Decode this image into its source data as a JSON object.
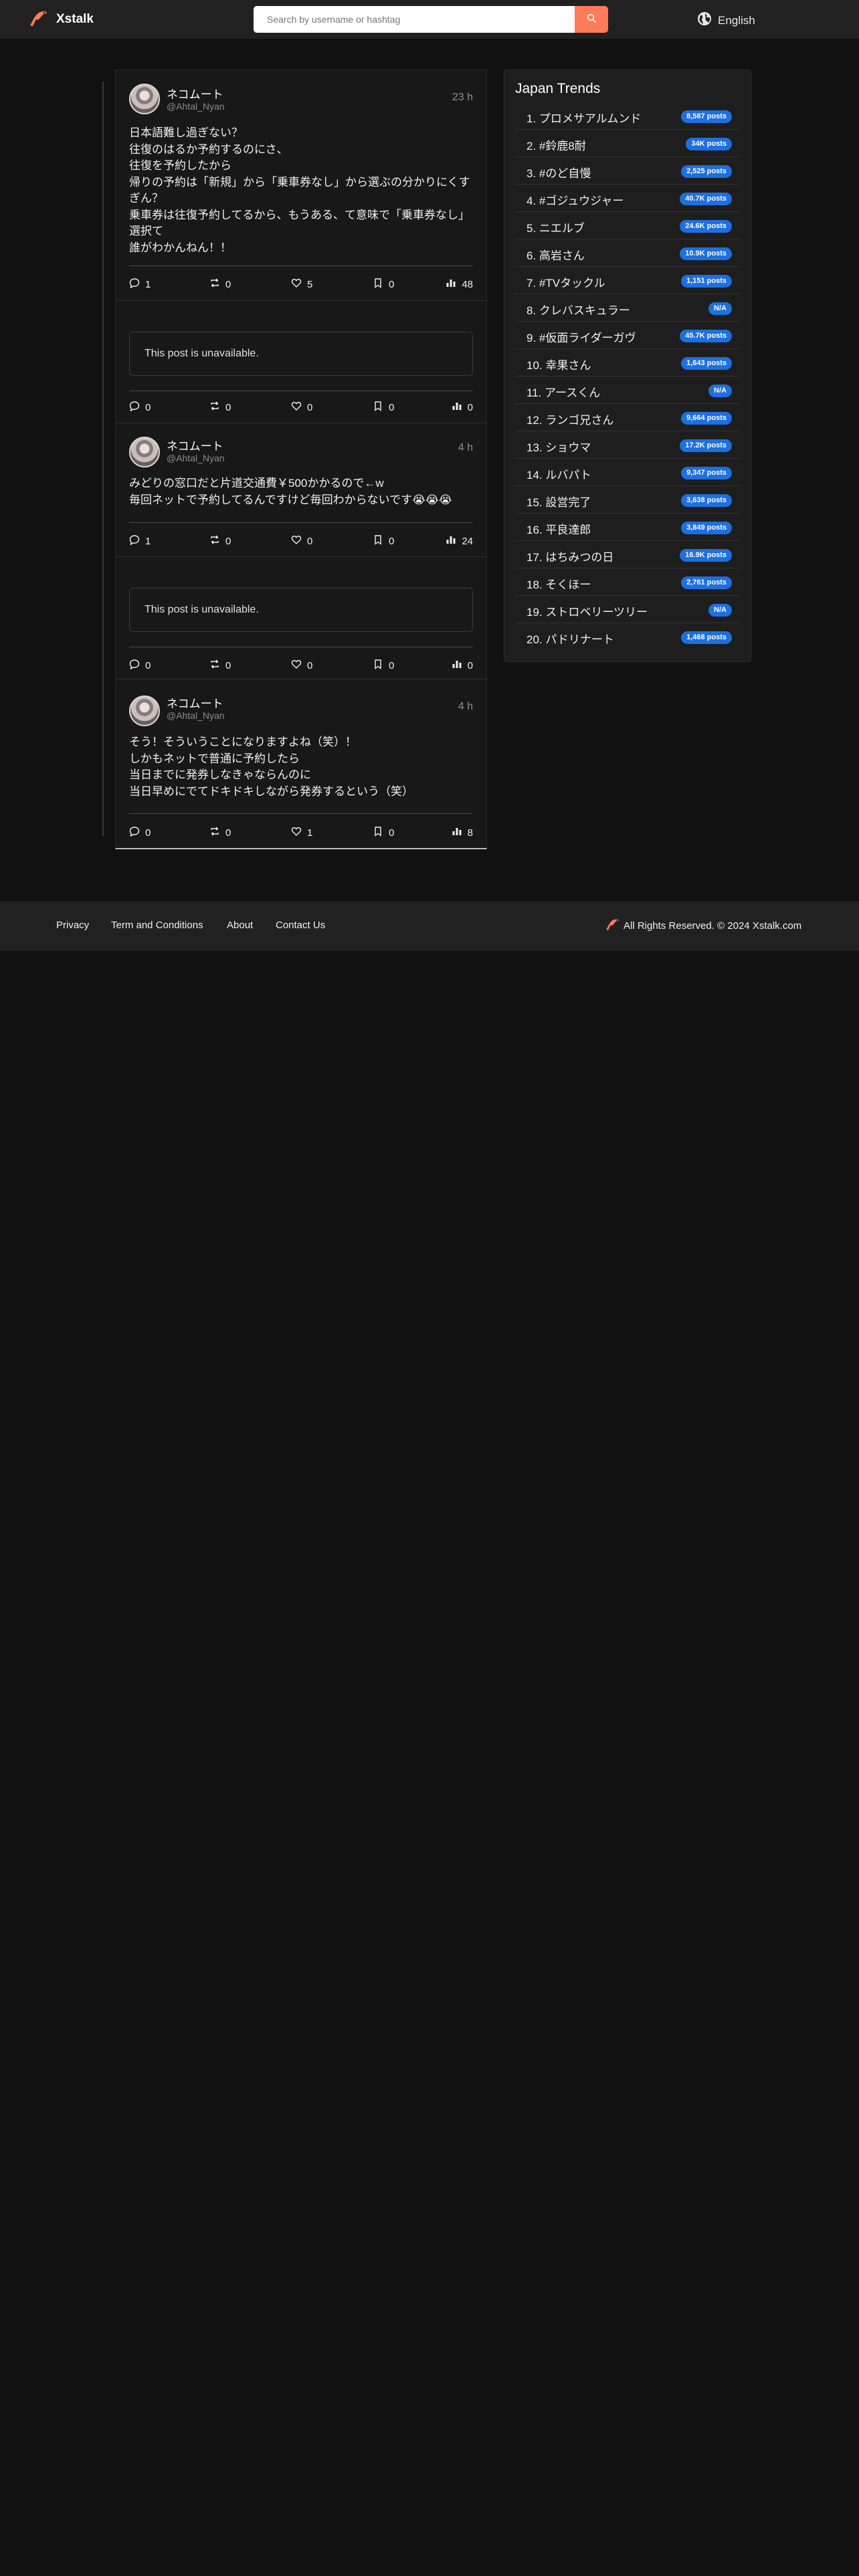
{
  "header": {
    "logo_text": "Xstalk",
    "search_placeholder": "Search by username or hashtag",
    "language": "English"
  },
  "posts": [
    {
      "type": "post",
      "user": "ネコムート",
      "handle": "@Ahtal_Nyan",
      "time": "23 h",
      "text": "日本語難し過ぎない？\n往復のはるか予約するのにさ、\n往復を予約したから\n帰りの予約は「新規」から「乗車券なし」から選ぶの分かりにくすぎん？\n乗車券は往復予約してるから、もうある、て意味で「乗車券なし」選択て\n誰がわかんねん！！",
      "replies": "1",
      "retweets": "0",
      "likes": "5",
      "bookmarks": "0",
      "views": "48"
    },
    {
      "type": "unavailable",
      "message": "This post is unavailable.",
      "replies": "0",
      "retweets": "0",
      "likes": "0",
      "bookmarks": "0",
      "views": "0"
    },
    {
      "type": "post",
      "user": "ネコムート",
      "handle": "@Ahtal_Nyan",
      "time": "4 h",
      "text": "みどりの窓口だと片道交通費￥500かかるので←w\n毎回ネットで予約してるんですけど毎回わからないです😭😭😭",
      "replies": "1",
      "retweets": "0",
      "likes": "0",
      "bookmarks": "0",
      "views": "24"
    },
    {
      "type": "unavailable",
      "message": "This post is unavailable.",
      "replies": "0",
      "retweets": "0",
      "likes": "0",
      "bookmarks": "0",
      "views": "0"
    },
    {
      "type": "post",
      "user": "ネコムート",
      "handle": "@Ahtal_Nyan",
      "time": "4 h",
      "text": "そう！そういうことになりますよね（笑）！\nしかもネットで普通に予約したら\n当日までに発券しなきゃならんのに\n当日早めにでてドキドキしながら発券するという（笑）",
      "replies": "0",
      "retweets": "0",
      "likes": "1",
      "bookmarks": "0",
      "views": "8"
    }
  ],
  "trends": {
    "title": "Japan Trends",
    "items": [
      {
        "name": "1. プロメサアルムンド",
        "count": "8,587 posts"
      },
      {
        "name": "2. #鈴鹿8耐",
        "count": "34K posts"
      },
      {
        "name": "3. #のど自慢",
        "count": "2,525 posts"
      },
      {
        "name": "4. #ゴジュウジャー",
        "count": "40.7K posts"
      },
      {
        "name": "5. ニエルブ",
        "count": "24.6K posts"
      },
      {
        "name": "6. 高岩さん",
        "count": "10.9K posts"
      },
      {
        "name": "7. #TVタックル",
        "count": "1,151 posts"
      },
      {
        "name": "8. クレバスキュラー",
        "count": "N/A"
      },
      {
        "name": "9. #仮面ライダーガヴ",
        "count": "45.7K posts"
      },
      {
        "name": "10. 幸果さん",
        "count": "1,643 posts"
      },
      {
        "name": "11. アースくん",
        "count": "N/A"
      },
      {
        "name": "12. ランゴ兄さん",
        "count": "9,664 posts"
      },
      {
        "name": "13. ショウマ",
        "count": "17.2K posts"
      },
      {
        "name": "14. ルバパト",
        "count": "9,347 posts"
      },
      {
        "name": "15. 設営完了",
        "count": "3,638 posts"
      },
      {
        "name": "16. 平良達郎",
        "count": "3,849 posts"
      },
      {
        "name": "17. はちみつの日",
        "count": "16.9K posts"
      },
      {
        "name": "18. そくほー",
        "count": "2,761 posts"
      },
      {
        "name": "19. ストロベリーツリー",
        "count": "N/A"
      },
      {
        "name": "20. パドリナート",
        "count": "1,468 posts"
      }
    ]
  },
  "footer": {
    "links": [
      "Privacy",
      "Term and Conditions",
      "About",
      "Contact Us"
    ],
    "copyright": "All Rights Reserved. © 2024 Xstalk.com"
  },
  "colors": {
    "accent": "#ff7b5a",
    "badge": "#1e6fe0",
    "background": "#111111",
    "header": "#212121"
  },
  "icons": [
    "logo-icon",
    "search-icon",
    "globe-icon",
    "reply-icon",
    "retweet-icon",
    "heart-icon",
    "bookmark-icon",
    "views-icon"
  ]
}
